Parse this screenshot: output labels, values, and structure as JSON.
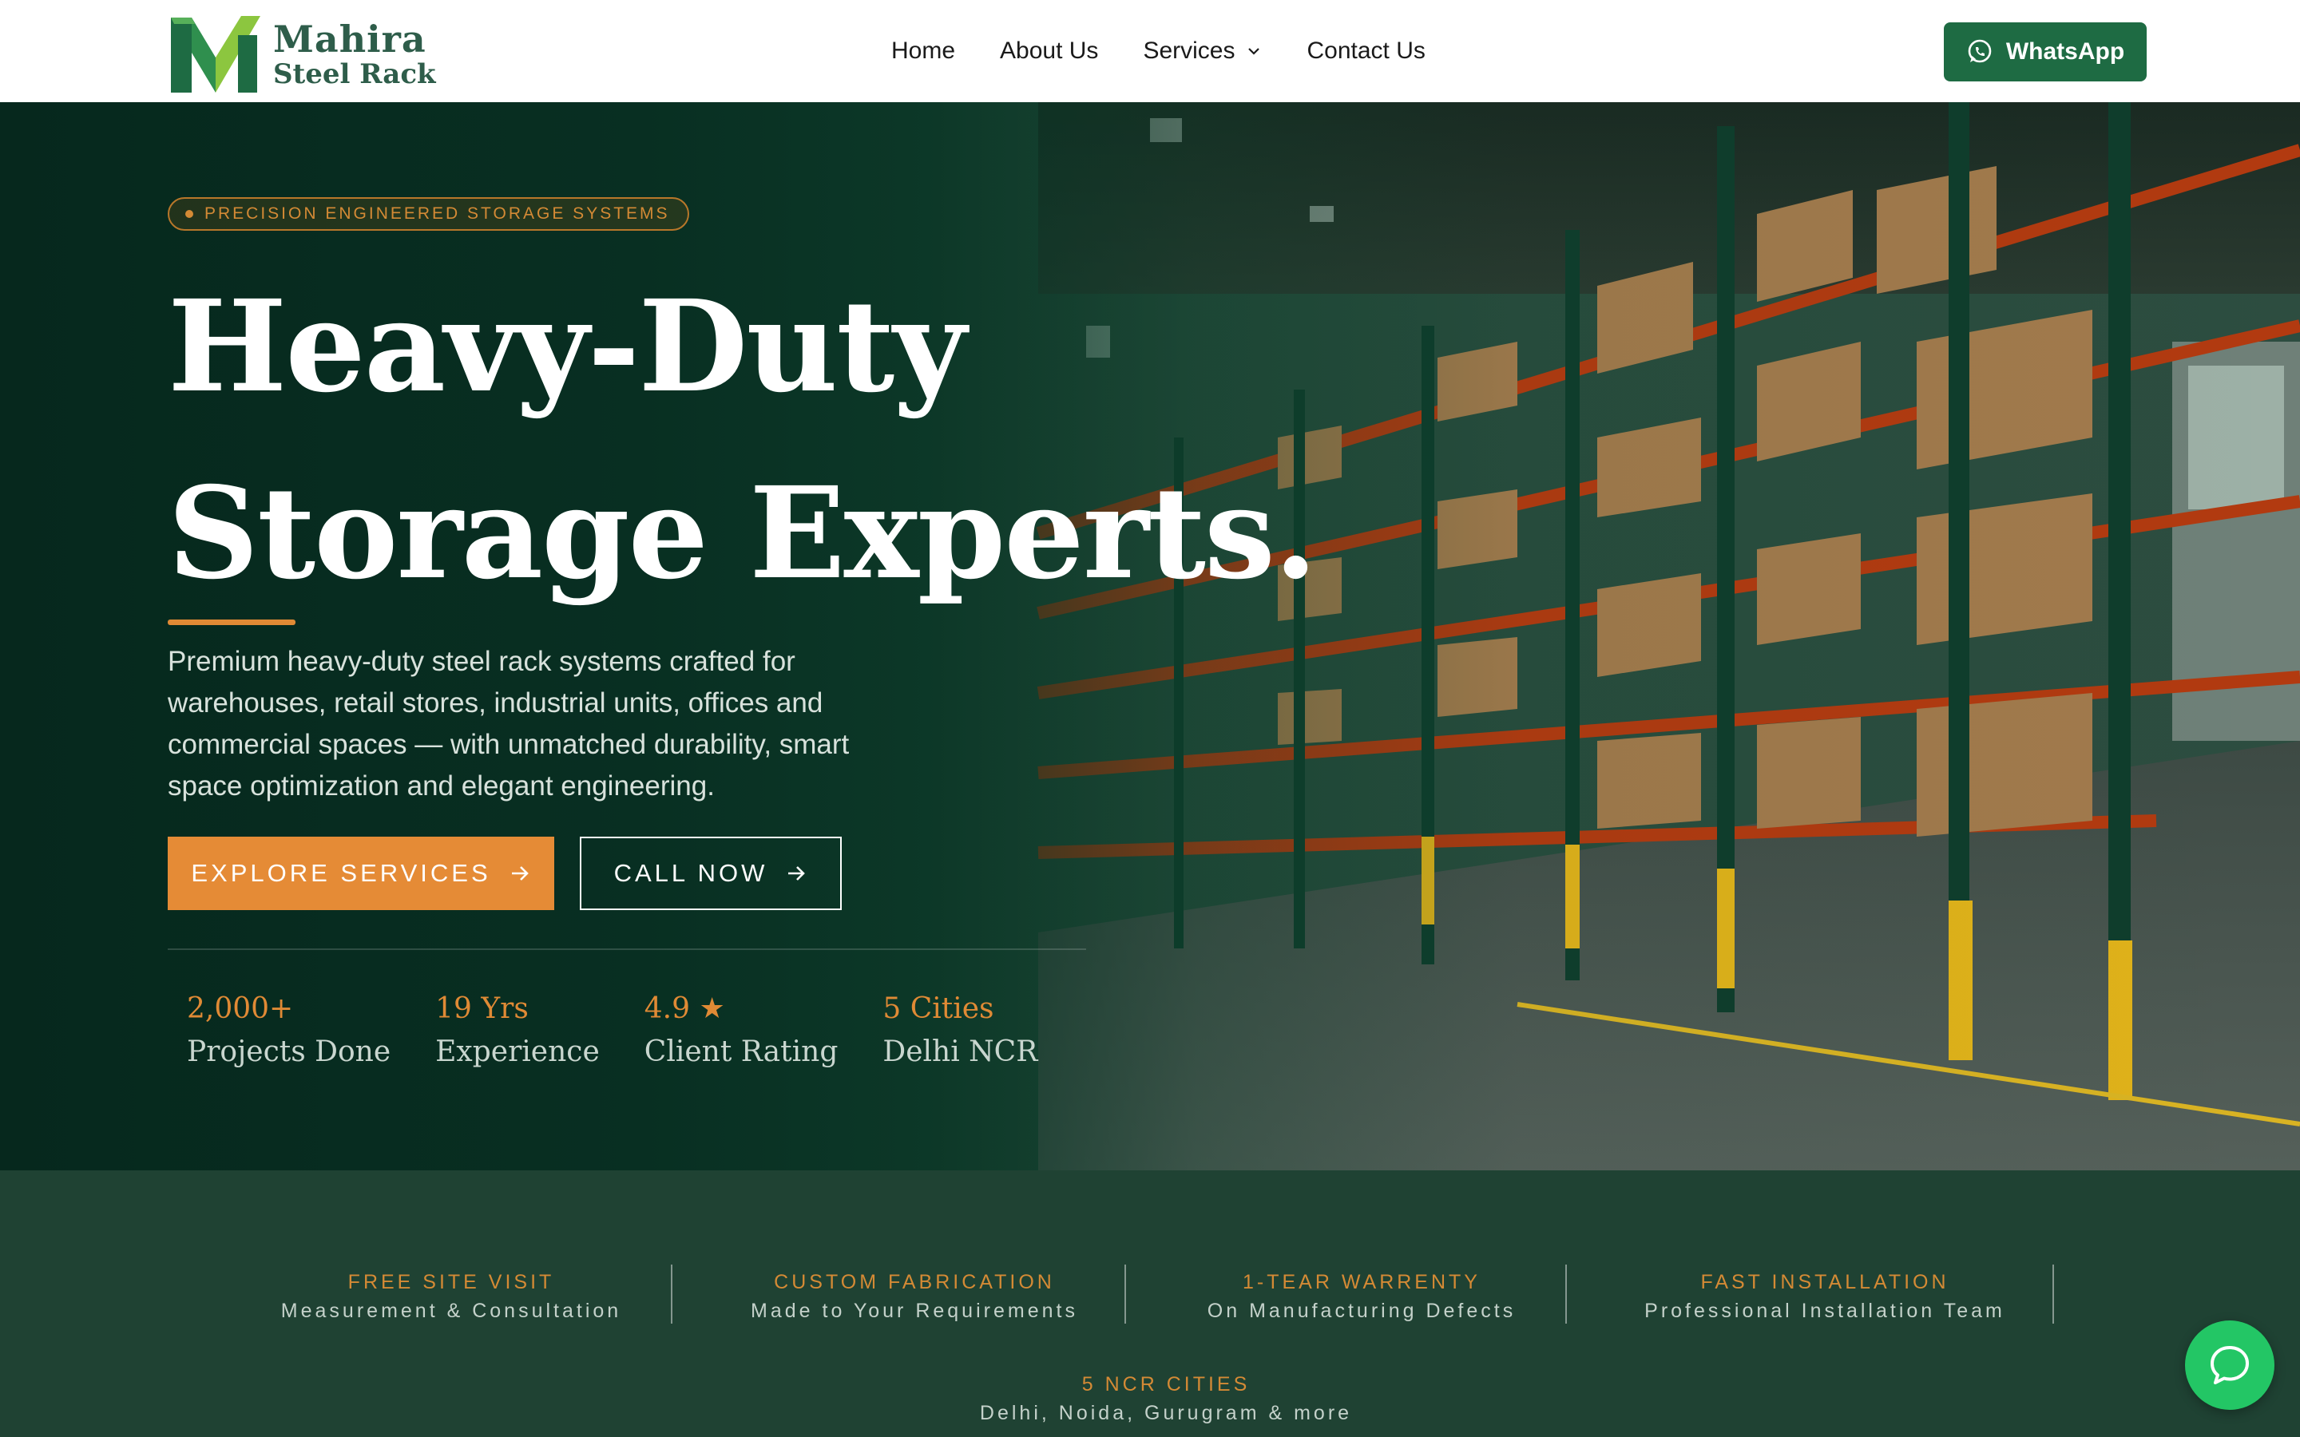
{
  "brand": {
    "name": "Mahira",
    "subtitle": "Steel Rack",
    "icon": "m-logo-icon",
    "colors": {
      "green": "#1e6b43",
      "green_light": "#3fa35a",
      "text": "#2e5d4a"
    }
  },
  "nav": {
    "items": [
      {
        "label": "Home"
      },
      {
        "label": "About Us"
      },
      {
        "label": "Services",
        "icon": "chevron-down-icon"
      },
      {
        "label": "Contact Us"
      }
    ],
    "whatsapp_label": "WhatsApp",
    "whatsapp_icon": "whatsapp-icon"
  },
  "hero": {
    "badge": "PRECISION ENGINEERED STORAGE SYSTEMS",
    "title_line1": "Heavy-Duty",
    "title_line2": "Storage Experts.",
    "description": "Premium heavy-duty steel rack systems crafted for warehouses, retail stores, industrial units, offices and commercial spaces — with unmatched durability, smart space optimization and elegant engineering.",
    "primary_button": "EXPLORE SERVICES",
    "secondary_button": "CALL NOW",
    "button_icon": "arrow-right-icon",
    "accent_color": "#e58b36",
    "stats": [
      {
        "value": "2,000+",
        "label": "Projects Done"
      },
      {
        "value": "19 Yrs",
        "label": "Experience"
      },
      {
        "value": "4.9 ★",
        "label": "Client Rating"
      },
      {
        "value": "5 Cities",
        "label": "Delhi NCR"
      }
    ]
  },
  "features": [
    {
      "title": "FREE SITE VISIT",
      "subtitle": "Measurement & Consultation"
    },
    {
      "title": "CUSTOM FABRICATION",
      "subtitle": "Made to Your Requirements"
    },
    {
      "title": "1-TEAR WARRENTY",
      "subtitle": "On Manufacturing Defects"
    },
    {
      "title": "FAST INSTALLATION",
      "subtitle": "Professional Installation Team"
    },
    {
      "title": "5 NCR CITIES",
      "subtitle": "Delhi, Noida, Gurugram & more"
    }
  ],
  "chat_fab": {
    "icon": "chat-bubble-icon",
    "color": "#23c665"
  }
}
